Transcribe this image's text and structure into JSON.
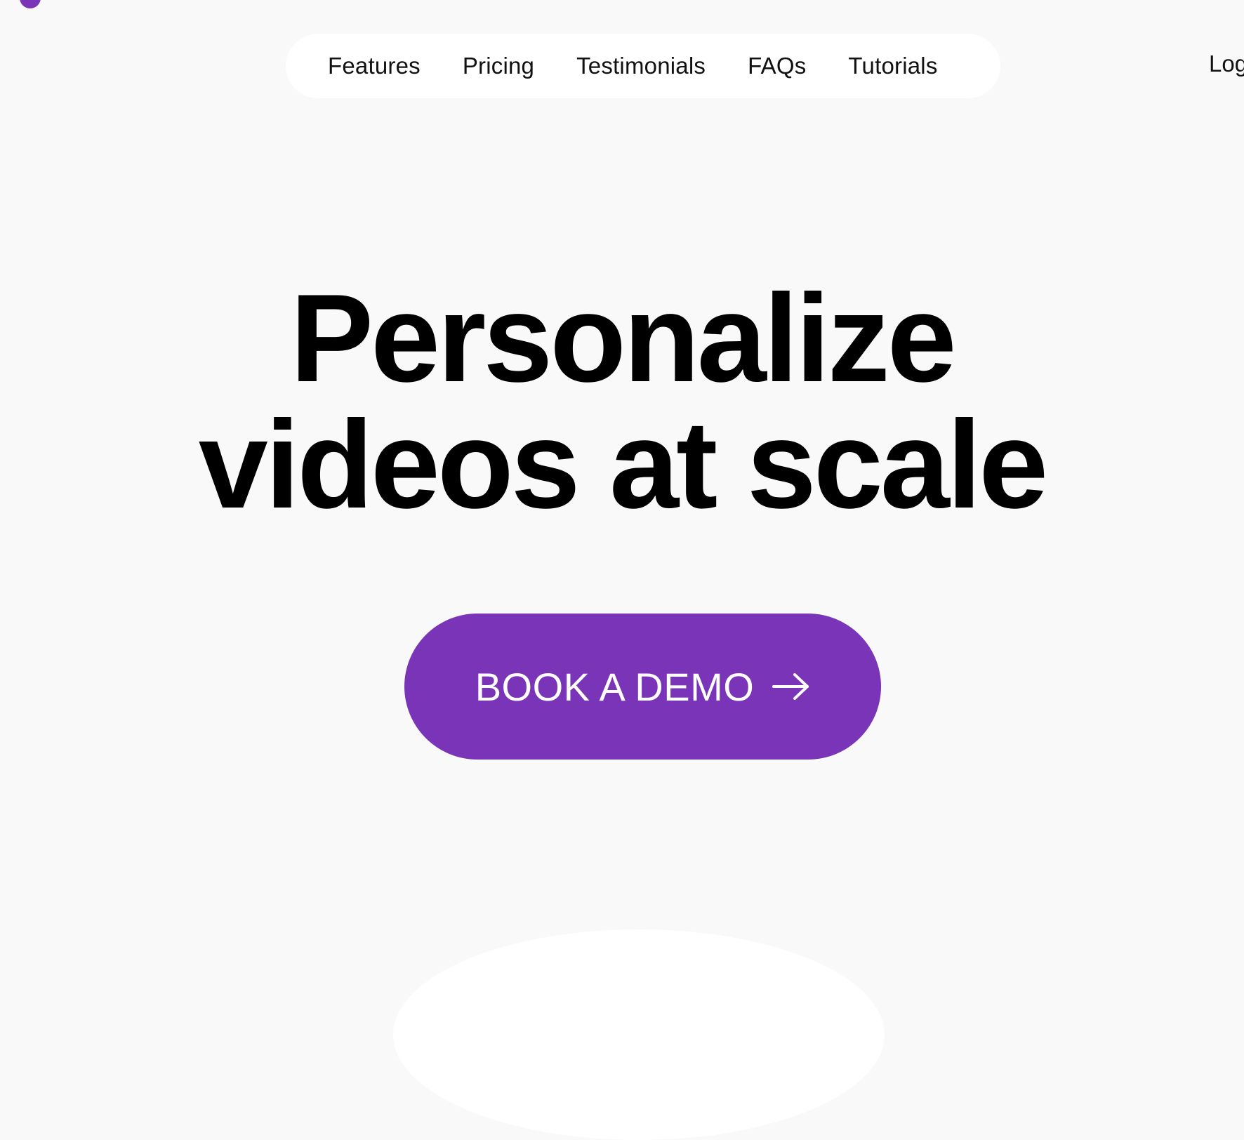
{
  "brand": {
    "logo_icon": "purple-dot-logo",
    "accent_color": "#7a34b8"
  },
  "nav": {
    "items": [
      {
        "label": "Features"
      },
      {
        "label": "Pricing"
      },
      {
        "label": "Testimonials"
      },
      {
        "label": "FAQs"
      },
      {
        "label": "Tutorials"
      }
    ],
    "login_label": "Log"
  },
  "hero": {
    "title_line1": "Personalize",
    "title_line2": "videos at scale",
    "cta_label": "BOOK A DEMO",
    "cta_icon": "arrow-right-icon"
  },
  "colors": {
    "background": "#f9f9f9",
    "nav_background": "#ffffff",
    "cta_background": "#7a34b8",
    "cta_text": "#ffffff"
  }
}
